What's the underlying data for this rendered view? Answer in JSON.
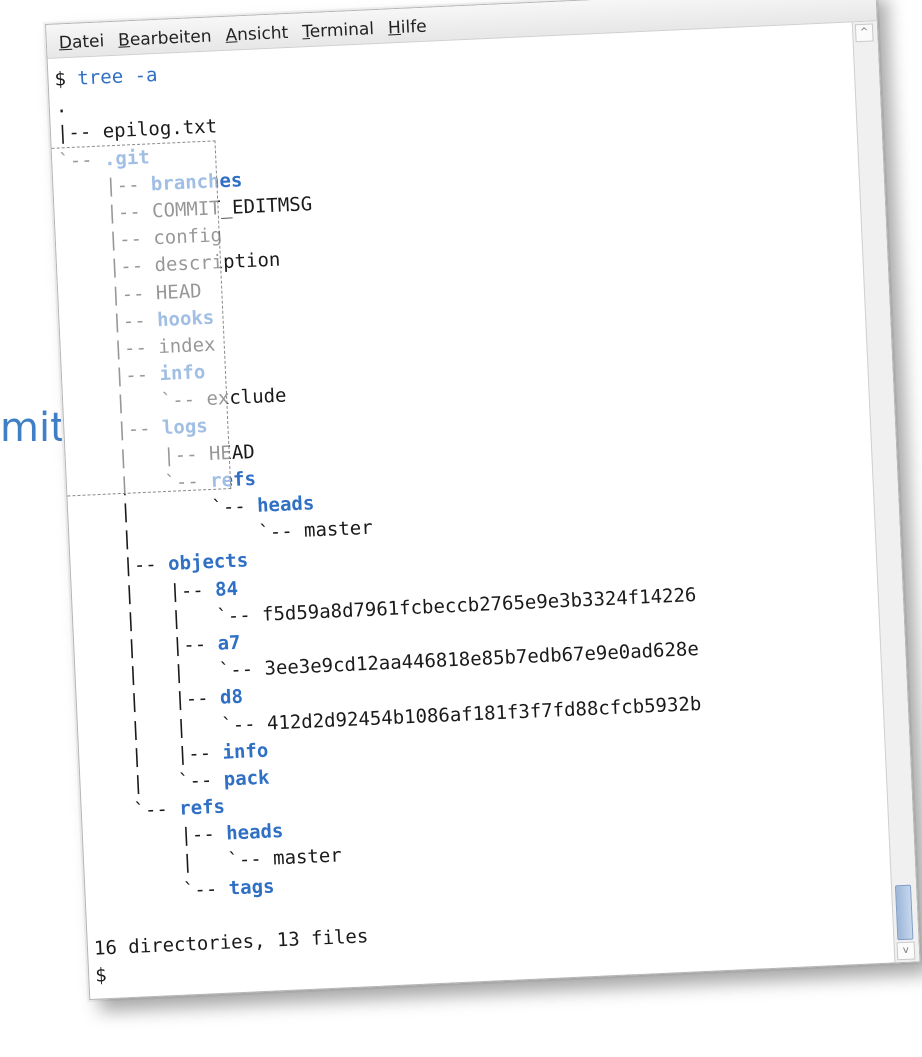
{
  "partial": {
    "text": "mit",
    "quote": "\""
  },
  "menu": [
    {
      "accel": "D",
      "rest": "atei"
    },
    {
      "accel": "B",
      "rest": "earbeiten"
    },
    {
      "accel": "A",
      "rest": "nsicht"
    },
    {
      "accel": "T",
      "rest": "erminal"
    },
    {
      "accel": "H",
      "rest": "ilfe"
    }
  ],
  "scroll": {
    "up_glyph": "^",
    "down_glyph": "v",
    "position_fraction": 1.0
  },
  "terminal": {
    "prompt": "$ ",
    "command": "tree",
    "argument": " -a",
    "lines": [
      {
        "prefix": ".",
        "name": "",
        "dir": false
      },
      {
        "prefix": "|-- ",
        "name": "epilog.txt",
        "dir": false
      },
      {
        "prefix": "`-- ",
        "name": ".git",
        "dir": true
      },
      {
        "prefix": "    |-- ",
        "name": "branches",
        "dir": true
      },
      {
        "prefix": "    |-- ",
        "name": "COMMIT_EDITMSG",
        "dir": false
      },
      {
        "prefix": "    |-- ",
        "name": "config",
        "dir": false
      },
      {
        "prefix": "    |-- ",
        "name": "description",
        "dir": false
      },
      {
        "prefix": "    |-- ",
        "name": "HEAD",
        "dir": false
      },
      {
        "prefix": "    |-- ",
        "name": "hooks",
        "dir": true
      },
      {
        "prefix": "    |-- ",
        "name": "index",
        "dir": false
      },
      {
        "prefix": "    |-- ",
        "name": "info",
        "dir": true
      },
      {
        "prefix": "    |   `-- ",
        "name": "exclude",
        "dir": false
      },
      {
        "prefix": "    |-- ",
        "name": "logs",
        "dir": true
      },
      {
        "prefix": "    |   |-- ",
        "name": "HEAD",
        "dir": false
      },
      {
        "prefix": "    |   `-- ",
        "name": "refs",
        "dir": true
      },
      {
        "prefix": "    |       `-- ",
        "name": "heads",
        "dir": true
      },
      {
        "prefix": "    |           `-- ",
        "name": "master",
        "dir": false
      },
      {
        "prefix": "    |-- ",
        "name": "objects",
        "dir": true
      },
      {
        "prefix": "    |   |-- ",
        "name": "84",
        "dir": true
      },
      {
        "prefix": "    |   |   `-- ",
        "name": "f5d59a8d7961fcbeccb2765e9e3b3324f14226",
        "dir": false
      },
      {
        "prefix": "    |   |-- ",
        "name": "a7",
        "dir": true
      },
      {
        "prefix": "    |   |   `-- ",
        "name": "3ee3e9cd12aa446818e85b7edb67e9e0ad628e",
        "dir": false
      },
      {
        "prefix": "    |   |-- ",
        "name": "d8",
        "dir": true
      },
      {
        "prefix": "    |   |   `-- ",
        "name": "412d2d92454b1086af181f3f7fd88cfcb5932b",
        "dir": false
      },
      {
        "prefix": "    |   |-- ",
        "name": "info",
        "dir": true
      },
      {
        "prefix": "    |   `-- ",
        "name": "pack",
        "dir": true
      },
      {
        "prefix": "    `-- ",
        "name": "refs",
        "dir": true
      },
      {
        "prefix": "        |-- ",
        "name": "heads",
        "dir": true
      },
      {
        "prefix": "        |   `-- ",
        "name": "master",
        "dir": false
      },
      {
        "prefix": "        `-- ",
        "name": "tags",
        "dir": true
      },
      {
        "prefix": "",
        "name": "",
        "dir": false
      },
      {
        "prefix": "16 directories, 13 files",
        "name": "",
        "dir": false
      },
      {
        "prefix": "$",
        "name": "",
        "dir": false
      }
    ]
  }
}
